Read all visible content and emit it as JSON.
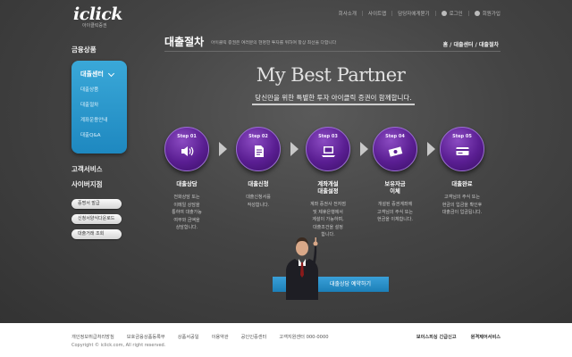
{
  "header": {
    "logo": "iclick",
    "logo_sub": "아이클릭증권",
    "nav": [
      "회사소개",
      "사이트맵",
      "담당자에게묻기",
      "로그인",
      "회원가입"
    ]
  },
  "sidebar": {
    "category_title": "금융상품",
    "submenu_title": "대출센터",
    "submenu_items": [
      "대출상품",
      "대출절차",
      "계좌운용안내",
      "대출Q&A"
    ],
    "customer_title": "고객서비스",
    "branch_title": "사이버지점",
    "buttons": [
      "증명서 발급",
      "신청서양식다운로드",
      "대출거래 조회"
    ]
  },
  "main": {
    "title": "대출절차",
    "description": "아이클릭 증권은 여러분의 현명한 투자를 위하여 항상 최선을 다합니다",
    "breadcrumb": "홈 / 대출센터 / 대출절차",
    "hero_part1": "My Best",
    "hero_part2": "Partner",
    "tagline": "당신만을 위한 특별한 투자 아이클릭 증권이 함께합니다.",
    "cta_label": "대출상담 예약하기"
  },
  "steps": [
    {
      "no": "Step 01",
      "name": "대출상담",
      "desc": "전화상담 또는\n이메일 상담을\n통하여 대출가능\n여부와 금액을\n상담합니다.",
      "icon": "speaker-icon"
    },
    {
      "no": "Step 02",
      "name": "대출신청",
      "desc": "대출신청서를\n작성합니다.",
      "icon": "document-icon"
    },
    {
      "no": "Step 03",
      "name": "계좌개설\n대출설정",
      "desc": "계좌 증권사 전자점\n및 제휴은행에서\n계설이 가능하며,\n대출조건을 설정\n합니다.",
      "icon": "laptop-icon"
    },
    {
      "no": "Step 04",
      "name": "보유자금\n이체",
      "desc": "개설된 증권계좌에\n고객님의 주식 또는\n현금을 이체합니다.",
      "icon": "money-icon"
    },
    {
      "no": "Step 05",
      "name": "대출완료",
      "desc": "고객님의 주식 또는\n현금의 입금을 확인후\n대출금이 입금됩니다.",
      "icon": "card-icon"
    }
  ],
  "footer": {
    "links": [
      "개인정보취급처리방침",
      "보호금융상품등록부",
      "상품서공일",
      "이용약관",
      "공인인증센터",
      "고객지원센터 000-0000"
    ],
    "copyright": "Copyright © iclick.com, All right reserved.",
    "right_links": [
      "보이스피싱 긴급신고",
      "원격제어서비스"
    ]
  },
  "colors": {
    "accent_blue": "#2a95cf",
    "step_purple": "#5a1e92",
    "background": "#3a3a3a"
  }
}
